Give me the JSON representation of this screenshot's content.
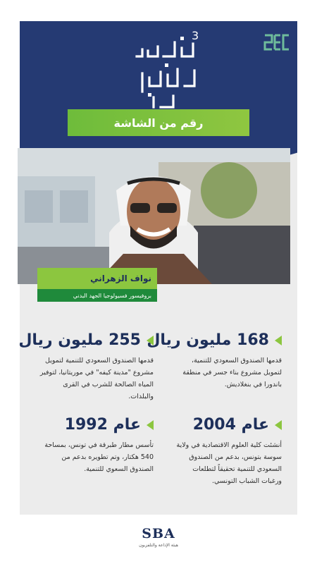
{
  "header": {
    "logo_text": "إعمار الأرض",
    "logo_number": "3",
    "brand_logo": "SEC",
    "subtitle": "رقم من الشاشة"
  },
  "speaker": {
    "name": "نواف الزهراني",
    "role": "بروفيسور فسيولوجيا الجهد البدني"
  },
  "facts": [
    {
      "headline": "168 مليون ريال",
      "text": "قدمها الصندوق السعودي للتنمية، لتمويل مشروع بناء جسر في منطقة باندورا في بنغلاديش."
    },
    {
      "headline": "255 مليون ريال",
      "text": "قدمها الصندوق السعودي للتنمية لتمويل مشروع \"مدينة كيفه\" في موريتانيا، لتوفير المياه الصالحة للشرب في القرى والبلدات."
    },
    {
      "headline": "عام 2004",
      "text": "أنشئت كلية العلوم الاقتصادية في ولاية سوسة بتونس، بدعم من الصندوق السعودي للتنمية تحقيقاً لتطلعات ورغبات الشباب التونسي."
    },
    {
      "headline": "عام 1992",
      "text": "تأسس مطار طبرقة في تونس، بمساحة 540 هكتار، وتم تطويره بدعم من الصندوق السعوي للتنمية."
    }
  ],
  "footer": {
    "logo_text": "SBA",
    "subtitle": "هيئة الإذاعة والتلفزيون"
  },
  "colors": {
    "navy": "#253a73",
    "green": "#8cc63f",
    "dark_green": "#1f8a3b"
  }
}
